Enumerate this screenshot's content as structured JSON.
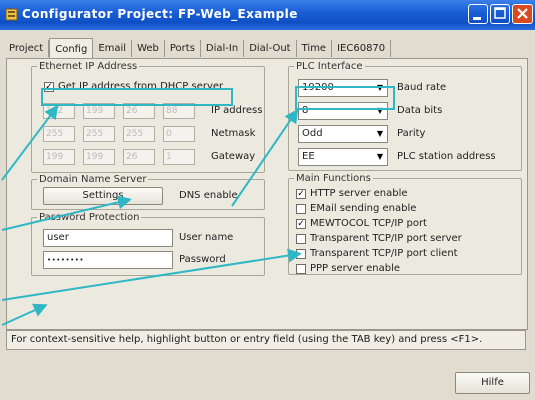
{
  "window": {
    "title": "Configurator Project: FP-Web_Example"
  },
  "tabs": [
    "Project",
    "Config",
    "Email",
    "Web",
    "Ports",
    "Dial-In",
    "Dial-Out",
    "Time",
    "IEC60870"
  ],
  "ethernet": {
    "legend": "Ethernet IP Address",
    "dhcp_label": "Get IP address from DHCP server",
    "dhcp_checked": "✓",
    "ip_label": "IP address",
    "netmask_label": "Netmask",
    "gateway_label": "Gateway",
    "ip": [
      "192",
      "199",
      "26",
      "88"
    ],
    "netmask": [
      "255",
      "255",
      "255",
      "0"
    ],
    "gateway": [
      "199",
      "199",
      "26",
      "1"
    ]
  },
  "dns": {
    "legend": "Domain Name Server",
    "button": "Settings",
    "label": "DNS enable"
  },
  "password": {
    "legend": "Password Protection",
    "username_value": "user",
    "username_label": "User name",
    "password_value": "••••••••",
    "password_label": "Password"
  },
  "plc": {
    "legend": "PLC Interface",
    "baud_value": "19200",
    "baud_label": "Baud rate",
    "databits_value": "8",
    "databits_label": "Data bits",
    "parity_value": "Odd",
    "parity_label": "Parity",
    "station_value": "EE",
    "station_label": "PLC station address"
  },
  "main": {
    "legend": "Main Functions",
    "items": [
      {
        "label": "HTTP server enable",
        "checked": "✓"
      },
      {
        "label": "EMail sending enable",
        "checked": ""
      },
      {
        "label": "MEWTOCOL TCP/IP port",
        "checked": "✓"
      },
      {
        "label": "Transparent TCP/IP port server",
        "checked": ""
      },
      {
        "label": "Transparent TCP/IP port client",
        "checked": ""
      },
      {
        "label": "PPP server enable",
        "checked": ""
      }
    ]
  },
  "status": "For context-sensitive help, highlight button or entry field (using the TAB key) and press <F1>.",
  "help_button": "Hilfe",
  "colors": {
    "titlebar": "#1a5fd6",
    "callout": "#30b7c6"
  }
}
